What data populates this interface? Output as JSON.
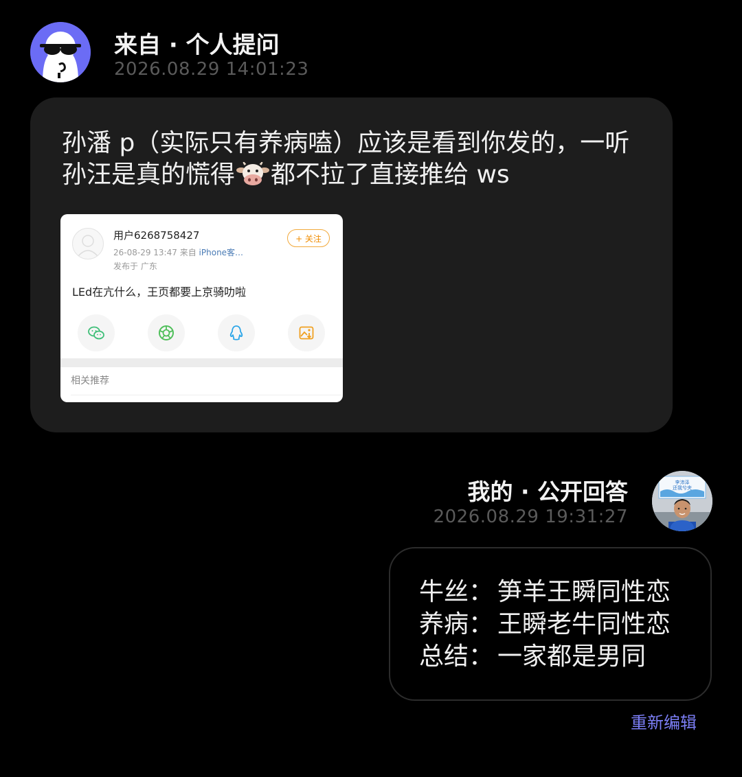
{
  "question": {
    "title": "来自 · 个人提问",
    "timestamp": "2026.08.29 14:01:23",
    "avatar_icon": "sunglasses-cartoon-avatar",
    "avatar_color": "#6b6cf5",
    "text_before_emoji": "孙潘 p（实际只有养病嗑）应该是看到你发的，一听孙汪是真的慌得",
    "emoji": "cow-face",
    "text_after_emoji": "都不拉了直接推给 ws",
    "embedded_card": {
      "username": "用户6268758427",
      "meta_time": "26-08-29 13:47",
      "meta_from": "来自",
      "meta_source": "iPhone客…",
      "location": "发布于 广东",
      "follow_label": "+ 关注",
      "body": "LEd在亢什么，王页都要上京骑叻啦",
      "share_icons": [
        "wechat-icon",
        "moments-icon",
        "qq-icon",
        "save-image-icon"
      ],
      "related_label": "相关推荐"
    }
  },
  "answer": {
    "title": "我的 · 公开回答",
    "timestamp": "2026.08.29 19:31:27",
    "avatar_sign_text": "李沛泽\n还我兮夹",
    "lines": [
      {
        "label": "牛丝：",
        "value": "笋羊王瞬同性恋"
      },
      {
        "label": "养病：",
        "value": "王瞬老牛同性恋"
      },
      {
        "label": "总结：",
        "value": "一家都是男同"
      }
    ],
    "edit_label": "重新编辑",
    "accent_color": "#7b7ef5"
  }
}
